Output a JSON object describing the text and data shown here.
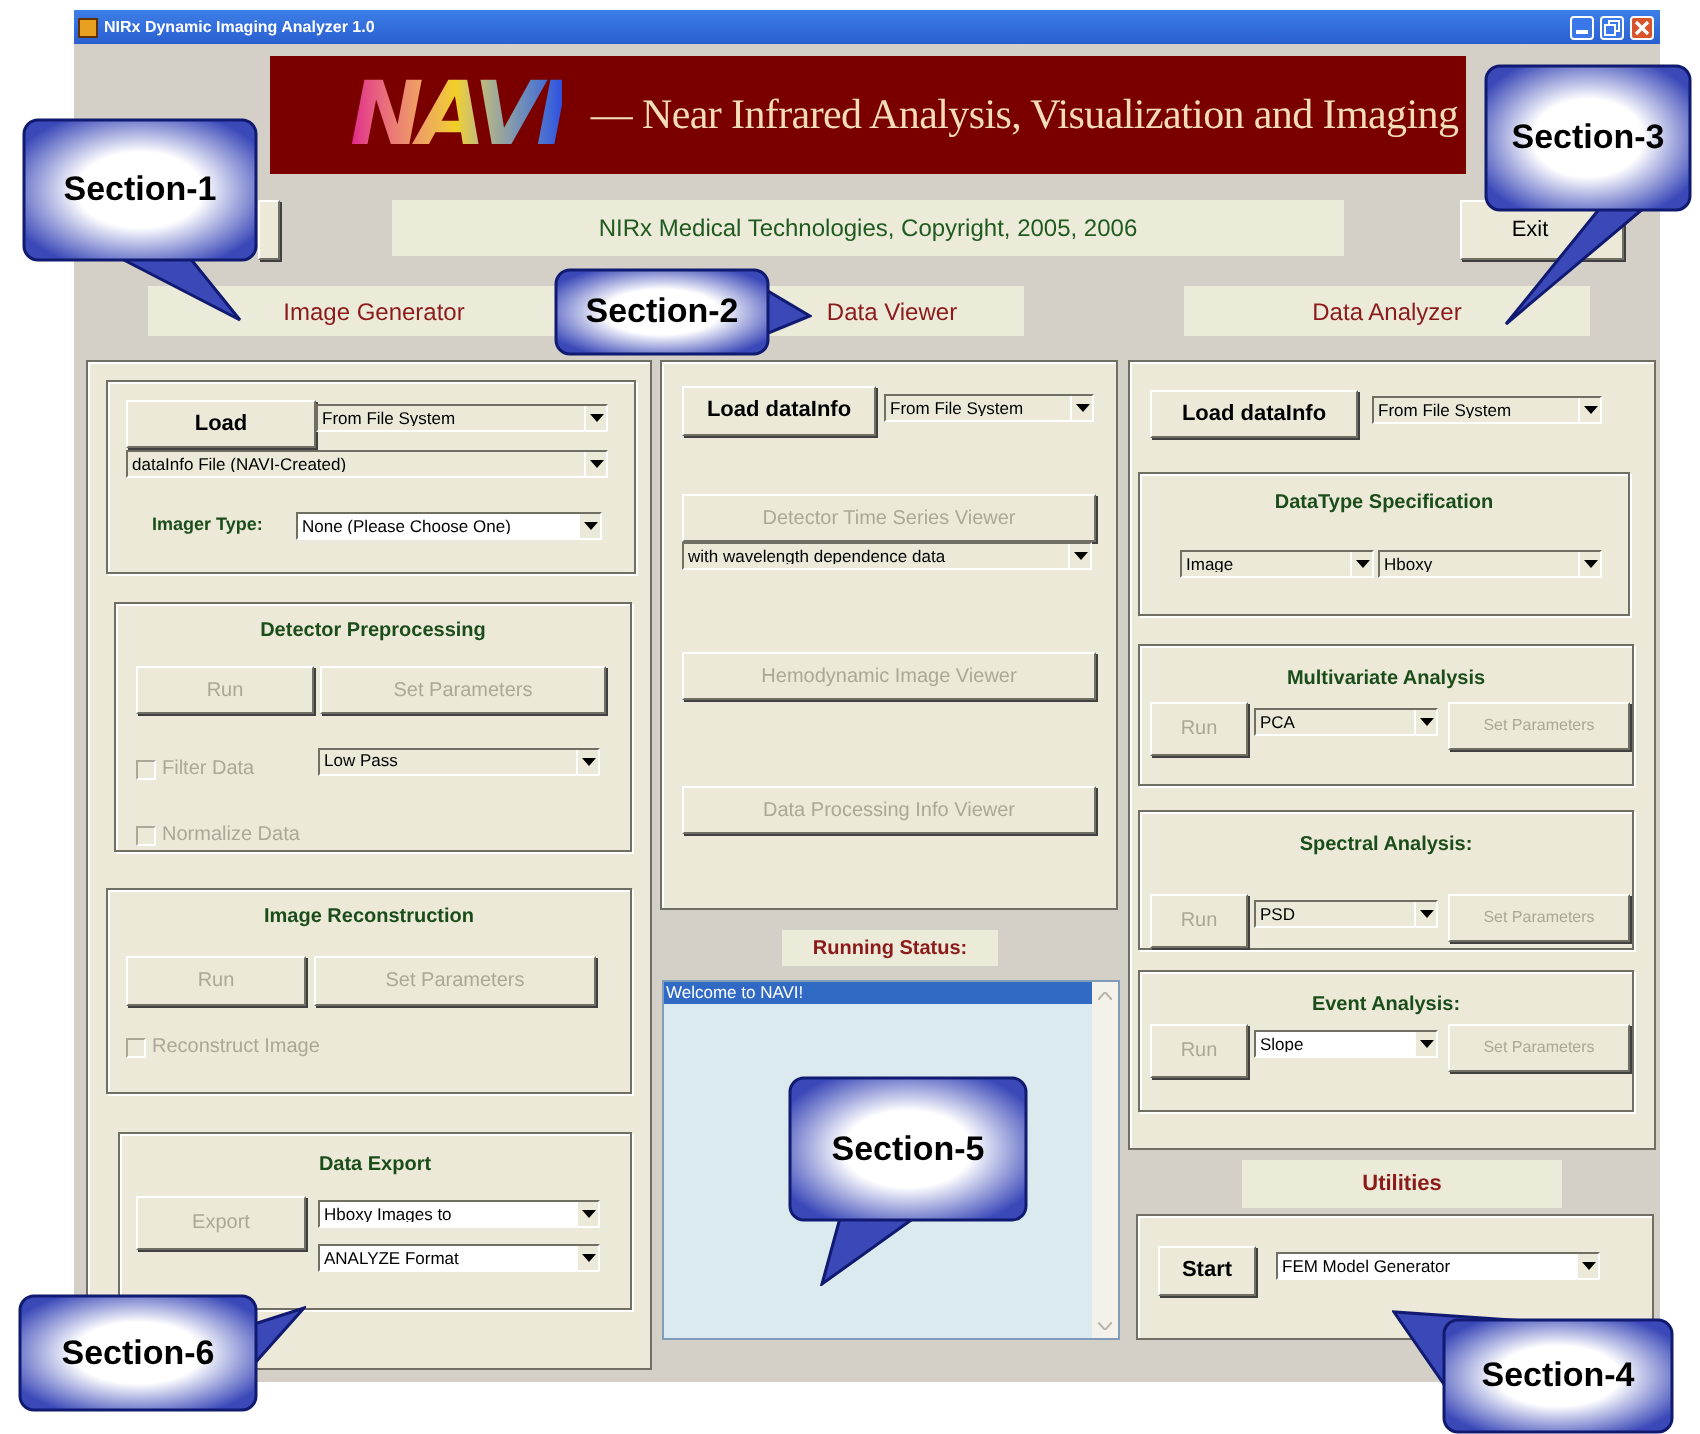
{
  "window": {
    "title": "NIRx Dynamic Imaging Analyzer 1.0"
  },
  "banner": {
    "logo": "NAVI",
    "tagline": "— Near Infrared Analysis, Visualization and Imaging"
  },
  "copyright": "NIRx Medical Technologies, Copyright, 2005, 2006",
  "exit_button": {
    "label": "Exit",
    "disabled": false
  },
  "image_generator": {
    "title": "Image Generator",
    "load_button": {
      "label": "Load",
      "disabled": false
    },
    "source": "From File System",
    "file_type": "dataInfo File  (NAVI-Created)",
    "imager_label": "Imager Type:",
    "imager_type": "None (Please Choose One)",
    "detector_preprocessing": {
      "title": "Detector Preprocessing",
      "run": {
        "label": "Run",
        "disabled": true
      },
      "set_parameters": {
        "label": "Set Parameters",
        "disabled": true
      },
      "filter": {
        "label": "Filter Data",
        "checked": false,
        "disabled": true
      },
      "filter_type": "Low Pass",
      "normalize": {
        "label": "Normalize Data",
        "checked": false,
        "disabled": true
      }
    },
    "image_reconstruction": {
      "title": "Image Reconstruction",
      "run": {
        "label": "Run",
        "disabled": true
      },
      "set_parameters": {
        "label": "Set Parameters",
        "disabled": true
      },
      "reconstruct": {
        "label": "Reconstruct Image",
        "checked": false,
        "disabled": true
      }
    },
    "data_export": {
      "title": "Data Export",
      "export": {
        "label": "Export",
        "disabled": true
      },
      "what": "Hboxy Images to",
      "format": "ANALYZE Format"
    }
  },
  "data_viewer": {
    "title": "Data Viewer",
    "load_button": {
      "label": "Load dataInfo",
      "disabled": false
    },
    "source": "From File System",
    "viewers": [
      {
        "label": "Detector Time Series Viewer",
        "disabled": true,
        "option": "with wavelength dependence data"
      },
      {
        "label": "Hemodynamic Image Viewer",
        "disabled": true
      },
      {
        "label": "Data Processing Info Viewer",
        "disabled": true
      }
    ],
    "status_title": "Running Status:",
    "status_lines": [
      {
        "text": "Welcome to NAVI!",
        "selected": true
      }
    ]
  },
  "data_analyzer": {
    "title": "Data Analyzer",
    "load_button": {
      "label": "Load dataInfo",
      "disabled": false
    },
    "source": "From File System",
    "datatype": {
      "title": "DataType Specification",
      "type": "Image",
      "species": "Hboxy"
    },
    "analyses": [
      {
        "title": "Multivariate Analysis",
        "run": {
          "label": "Run",
          "disabled": true
        },
        "method": "PCA",
        "set_parameters": {
          "label": "Set Parameters",
          "disabled": true
        }
      },
      {
        "title": "Spectral Analysis:",
        "run": {
          "label": "Run",
          "disabled": true
        },
        "method": "PSD",
        "set_parameters": {
          "label": "Set Parameters",
          "disabled": true
        }
      },
      {
        "title": "Event Analysis:",
        "run": {
          "label": "Run",
          "disabled": true
        },
        "method": "Slope",
        "set_parameters": {
          "label": "Set Parameters",
          "disabled": true
        }
      }
    ]
  },
  "utilities": {
    "title": "Utilities",
    "start": {
      "label": "Start",
      "disabled": false
    },
    "tool": "FEM Model Generator"
  },
  "callouts": [
    "Section-1",
    "Section-2",
    "Section-3",
    "Section-4",
    "Section-5",
    "Section-6"
  ]
}
